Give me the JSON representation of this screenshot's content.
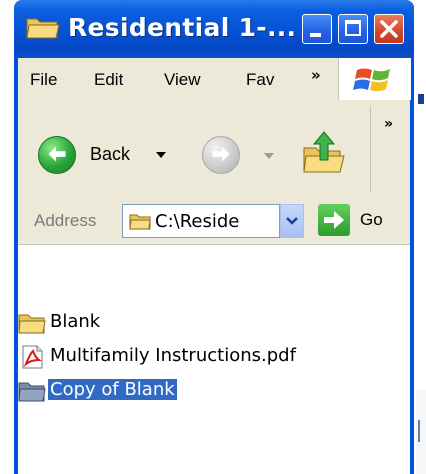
{
  "window": {
    "title": "Residential 1-...",
    "title_icon": "folder-icon",
    "controls": {
      "minimize": "minimize-icon",
      "maximize": "maximize-icon",
      "close": "close-icon"
    }
  },
  "menu": {
    "items": [
      "File",
      "Edit",
      "View",
      "Fav"
    ],
    "overflow": "»",
    "logo": "windows-logo-icon"
  },
  "toolbar": {
    "back_label": "Back",
    "overflow": "»",
    "icons": [
      "back-arrow-icon",
      "forward-arrow-icon",
      "up-folder-icon"
    ]
  },
  "address": {
    "label": "Address",
    "value": "C:\\Reside",
    "go_label": "Go"
  },
  "files": [
    {
      "name": "Blank",
      "icon": "folder-icon",
      "selected": false
    },
    {
      "name": "Multifamily Instructions.pdf",
      "icon": "pdf-file-icon",
      "selected": false
    },
    {
      "name": "Copy of Blank",
      "icon": "folder-icon",
      "selected": true
    }
  ],
  "colors": {
    "titlebar": "#0751d4",
    "selection": "#316ac5",
    "chrome": "#ece9d8"
  }
}
